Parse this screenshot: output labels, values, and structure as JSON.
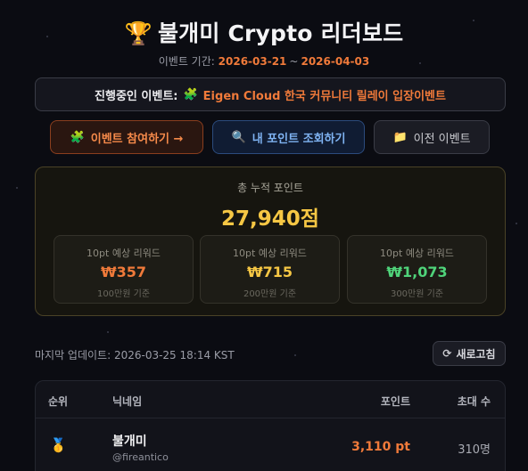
{
  "header": {
    "trophy_icon": "🏆",
    "title": "불개미 Crypto 리더보드",
    "period_label": "이벤트 기간:",
    "start_date": "2026-03-21",
    "separator": "~",
    "end_date": "2026-04-03"
  },
  "banner": {
    "label": "진행중인 이벤트:",
    "icon": "🧩",
    "event_name": "Eigen Cloud 한국 커뮤니티 릴레이 입장이벤트"
  },
  "actions": {
    "join": {
      "icon": "🧩",
      "label": "이벤트 참여하기 →"
    },
    "points": {
      "icon": "🔍",
      "label": "내 포인트 조회하기"
    },
    "previous": {
      "icon": "📁",
      "label": "이전 이벤트"
    }
  },
  "summary": {
    "label": "총 누적 포인트",
    "value": "27,940점",
    "rewards": [
      {
        "title": "10pt 예상 리워드",
        "value": "₩357",
        "basis": "100만원 기준"
      },
      {
        "title": "10pt 예상 리워드",
        "value": "₩715",
        "basis": "200만원 기준"
      },
      {
        "title": "10pt 예상 리워드",
        "value": "₩1,073",
        "basis": "300만원 기준"
      }
    ]
  },
  "status": {
    "updated": "마지막 업데이트: 2026-03-25 18:14 KST",
    "refresh_icon": "⟳",
    "refresh_label": "새로고침"
  },
  "table": {
    "headers": {
      "rank": "순위",
      "nickname": "닉네임",
      "points": "포인트",
      "invites": "초대 수"
    },
    "rows": [
      {
        "medal": "🥇",
        "nickname": "불개미",
        "handle": "@fireantico",
        "points": "3,110 pt",
        "invites": "310명"
      }
    ]
  },
  "colors": {
    "accent_orange": "#f07a3a",
    "accent_gold": "#f6c744",
    "accent_green": "#4fd37a",
    "accent_blue": "#7fb3f2",
    "background": "#0b0c12"
  }
}
